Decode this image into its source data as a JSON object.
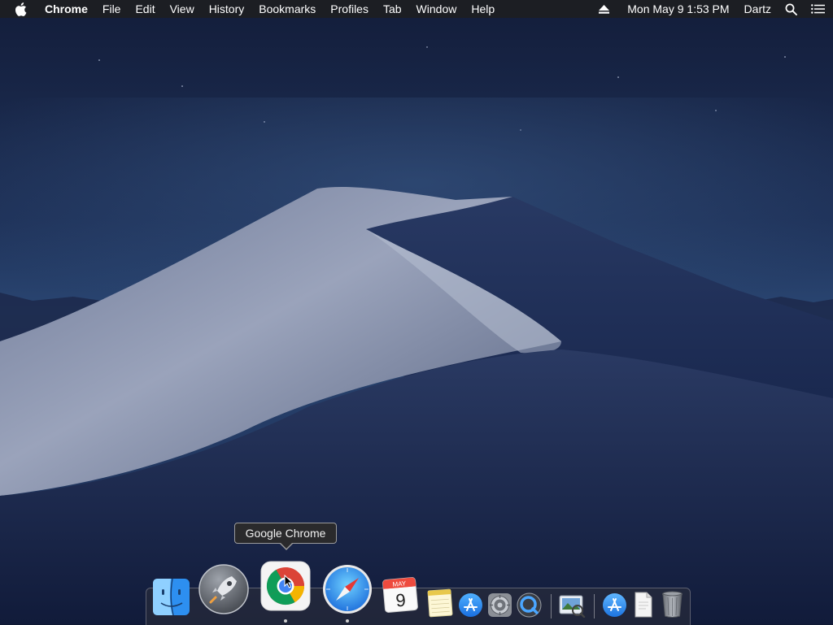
{
  "menubar": {
    "app_name": "Chrome",
    "menus": [
      "File",
      "Edit",
      "View",
      "History",
      "Bookmarks",
      "Profiles",
      "Tab",
      "Window",
      "Help"
    ],
    "clock": "Mon May 9  1:53 PM",
    "user": "Dartz",
    "icons": [
      "apple-icon",
      "eject-icon",
      "spotlight-search-icon",
      "notification-center-icon"
    ]
  },
  "tooltip": {
    "text": "Google Chrome"
  },
  "dock": {
    "apps": [
      {
        "name": "Finder",
        "icon": "finder-icon",
        "running": false
      },
      {
        "name": "Launchpad",
        "icon": "launchpad-icon",
        "running": false
      },
      {
        "name": "Google Chrome",
        "icon": "chrome-icon",
        "running": true,
        "hovered": true
      },
      {
        "name": "Safari",
        "icon": "safari-icon",
        "running": true
      },
      {
        "name": "Calendar",
        "icon": "calendar-icon",
        "running": false,
        "month": "MAY",
        "day": "9"
      },
      {
        "name": "Notes",
        "icon": "notes-icon",
        "running": false
      },
      {
        "name": "App Store",
        "icon": "app-store-icon",
        "running": false
      },
      {
        "name": "System Preferences",
        "icon": "system-preferences-icon",
        "running": false
      },
      {
        "name": "QuickTime Player",
        "icon": "quicktime-icon",
        "running": false
      },
      {
        "name": "Preview",
        "icon": "preview-icon",
        "running": false
      },
      {
        "name": "Applications",
        "icon": "applications-folder-icon",
        "running": false
      },
      {
        "name": "Documents",
        "icon": "document-icon",
        "running": false
      },
      {
        "name": "Trash",
        "icon": "trash-icon",
        "running": false
      }
    ]
  },
  "colors": {
    "sky_top": "#141f3d",
    "sky_mid": "#233a66",
    "dune_light": "#8a93ad",
    "dune_dark": "#1d2b52",
    "menubar": "#1e1e20"
  }
}
